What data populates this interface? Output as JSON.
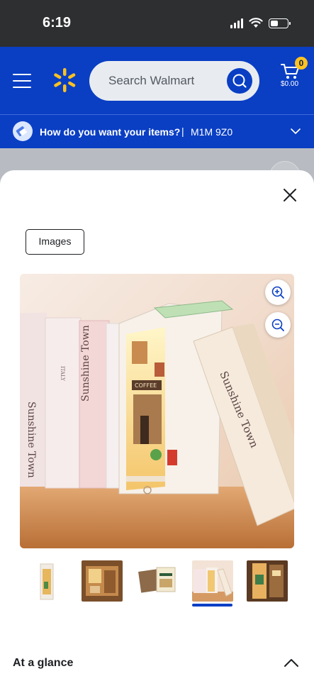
{
  "status_bar": {
    "time": "6:19"
  },
  "header": {
    "search_placeholder": "Search Walmart",
    "cart_count": "0",
    "cart_total": "$0.00"
  },
  "delivery": {
    "question": "How do you want your items?",
    "separator": "|",
    "postal_code": "M1M 9Z0"
  },
  "modal": {
    "images_tab": "Images",
    "product_image_text": {
      "book_spine_title": "Sunshine Town",
      "book_spine_small": "ITALY",
      "shop_sign": "COFFEE"
    },
    "thumbnail_count": 5,
    "selected_thumbnail": 4
  },
  "at_a_glance": {
    "label": "At a glance"
  },
  "colors": {
    "walmart_blue": "#0a3fc4",
    "spark_yellow": "#ffc220",
    "status_bar": "#2d2f31"
  }
}
